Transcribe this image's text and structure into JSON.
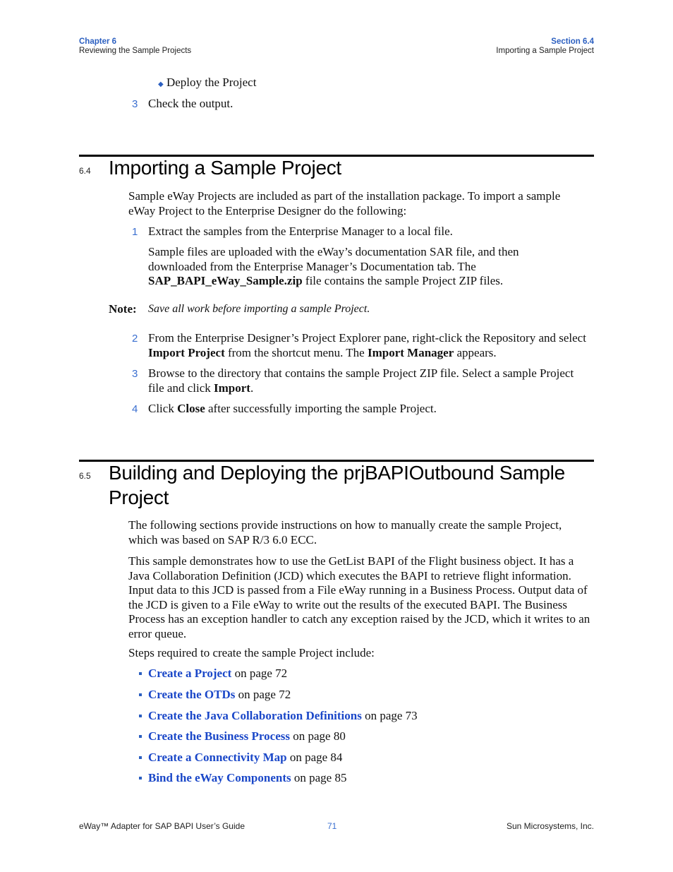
{
  "header": {
    "left": {
      "chapter": "Chapter 6",
      "title": "Reviewing the Sample Projects"
    },
    "right": {
      "section": "Section 6.4",
      "title": "Importing a Sample Project"
    }
  },
  "top_list": {
    "bullet_item": "Deploy the Project",
    "step3": {
      "num": "3",
      "text": "Check the output."
    }
  },
  "section_64": {
    "number": "6.4",
    "title": "Importing a Sample Project",
    "intro": "Sample eWay Projects are included as part of the installation package. To import a sample eWay Project to the Enterprise Designer do the following:",
    "step1": {
      "num": "1",
      "text": "Extract the samples from the Enterprise Manager to a local file."
    },
    "step1_detail": {
      "text_a": "Sample files are uploaded with the eWay’s documentation SAR file, and then downloaded from the Enterprise Manager’s Documentation tab. The ",
      "bold": "SAP_BAPI_eWay_Sample.zip",
      "text_b": " file contains the sample Project ZIP files."
    },
    "note": {
      "label": "Note:",
      "text": "Save all work before importing a sample Project."
    },
    "step2": {
      "num": "2",
      "a": "From the Enterprise Designer’s Project Explorer pane, right-click the Repository and select ",
      "b1": "Import Project",
      "c": " from the shortcut menu. The ",
      "b2": "Import Manager",
      "d": " appears."
    },
    "step3": {
      "num": "3",
      "a": "Browse to the directory that contains the sample Project ZIP file. Select a sample Project file and click ",
      "b": "Import",
      "c": "."
    },
    "step4": {
      "num": "4",
      "a": "Click ",
      "b": "Close",
      "c": " after successfully importing the sample Project."
    }
  },
  "section_65": {
    "number": "6.5",
    "title_line1": "Building and Deploying the prjBAPIOutbound Sample",
    "title_line2": "Project",
    "para1": "The following sections provide instructions on how to manually create the sample Project, which was based on SAP R/3 6.0 ECC.",
    "para2": "This sample demonstrates how to use the GetList BAPI of the Flight business object. It has a Java Collaboration Definition (JCD) which executes the BAPI to retrieve flight information. Input data to this JCD is passed from a File eWay running in a Business Process. Output data of the JCD is given to a File eWay to write out the results of the executed BAPI. The Business Process has an exception handler to catch any exception raised by the JCD, which it writes to an error queue.",
    "para3": "Steps required to create the sample Project include:",
    "links": [
      {
        "label": "Create a Project",
        "suffix": " on page 72"
      },
      {
        "label": "Create the OTDs",
        "suffix": " on page 72"
      },
      {
        "label": "Create the Java Collaboration Definitions",
        "suffix": " on page 73"
      },
      {
        "label": "Create the Business Process",
        "suffix": " on page 80"
      },
      {
        "label": "Create a Connectivity Map",
        "suffix": " on page 84"
      },
      {
        "label": "Bind the eWay Components",
        "suffix": " on page 85"
      }
    ]
  },
  "footer": {
    "left": "eWay™ Adapter for SAP BAPI User’s Guide",
    "page": "71",
    "right": "Sun Microsystems, Inc."
  },
  "colors": {
    "accent": "#2b5fc0",
    "link": "#1a47c8",
    "rule": "#000000"
  }
}
